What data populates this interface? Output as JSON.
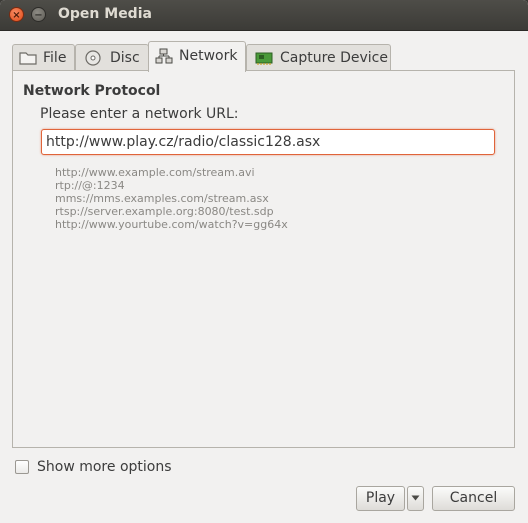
{
  "window": {
    "title": "Open Media"
  },
  "tabs": [
    {
      "label": "File",
      "icon": "folder-icon"
    },
    {
      "label": "Disc",
      "icon": "disc-icon"
    },
    {
      "label": "Network",
      "icon": "network-icon"
    },
    {
      "label": "Capture Device",
      "icon": "capture-card-icon"
    }
  ],
  "network": {
    "section_title": "Network Protocol",
    "prompt": "Please enter a network URL:",
    "url_value": "http://www.play.cz/radio/classic128.asx",
    "examples": [
      "http://www.example.com/stream.avi",
      "rtp://@:1234",
      "mms://mms.examples.com/stream.asx",
      "rtsp://server.example.org:8080/test.sdp",
      "http://www.yourtube.com/watch?v=gg64x"
    ]
  },
  "options": {
    "show_more_label": "Show more options",
    "show_more_checked": false
  },
  "buttons": {
    "play": "Play",
    "cancel": "Cancel"
  },
  "colors": {
    "accent": "#e0643a",
    "titlebar": "#3c3b37"
  }
}
